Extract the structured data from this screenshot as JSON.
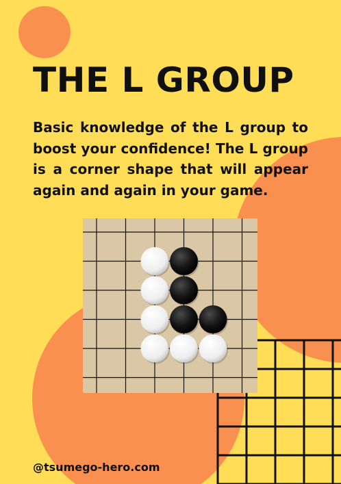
{
  "poster": {
    "title": "THE L GROUP",
    "description": "Basic knowledge of the L group to boost your confidence! The L group is a corner shape that will appear again and again in your game.",
    "handle": "@tsumego-hero.com"
  },
  "colors": {
    "background": "#FFDD57",
    "accent_orange": "#F9904F",
    "text": "#111111",
    "board_wood": "#DCCAAA",
    "grid_line": "#111111",
    "black_stone": "#111111",
    "white_stone": "#F2F2F2"
  },
  "board": {
    "stones": [
      {
        "color": "white",
        "col": 2,
        "row": 1
      },
      {
        "color": "black",
        "col": 3,
        "row": 1
      },
      {
        "color": "white",
        "col": 2,
        "row": 2
      },
      {
        "color": "black",
        "col": 3,
        "row": 2
      },
      {
        "color": "white",
        "col": 2,
        "row": 3
      },
      {
        "color": "black",
        "col": 3,
        "row": 3
      },
      {
        "color": "black",
        "col": 4,
        "row": 3
      },
      {
        "color": "white",
        "col": 2,
        "row": 4
      },
      {
        "color": "white",
        "col": 3,
        "row": 4
      },
      {
        "color": "white",
        "col": 4,
        "row": 4
      }
    ]
  }
}
